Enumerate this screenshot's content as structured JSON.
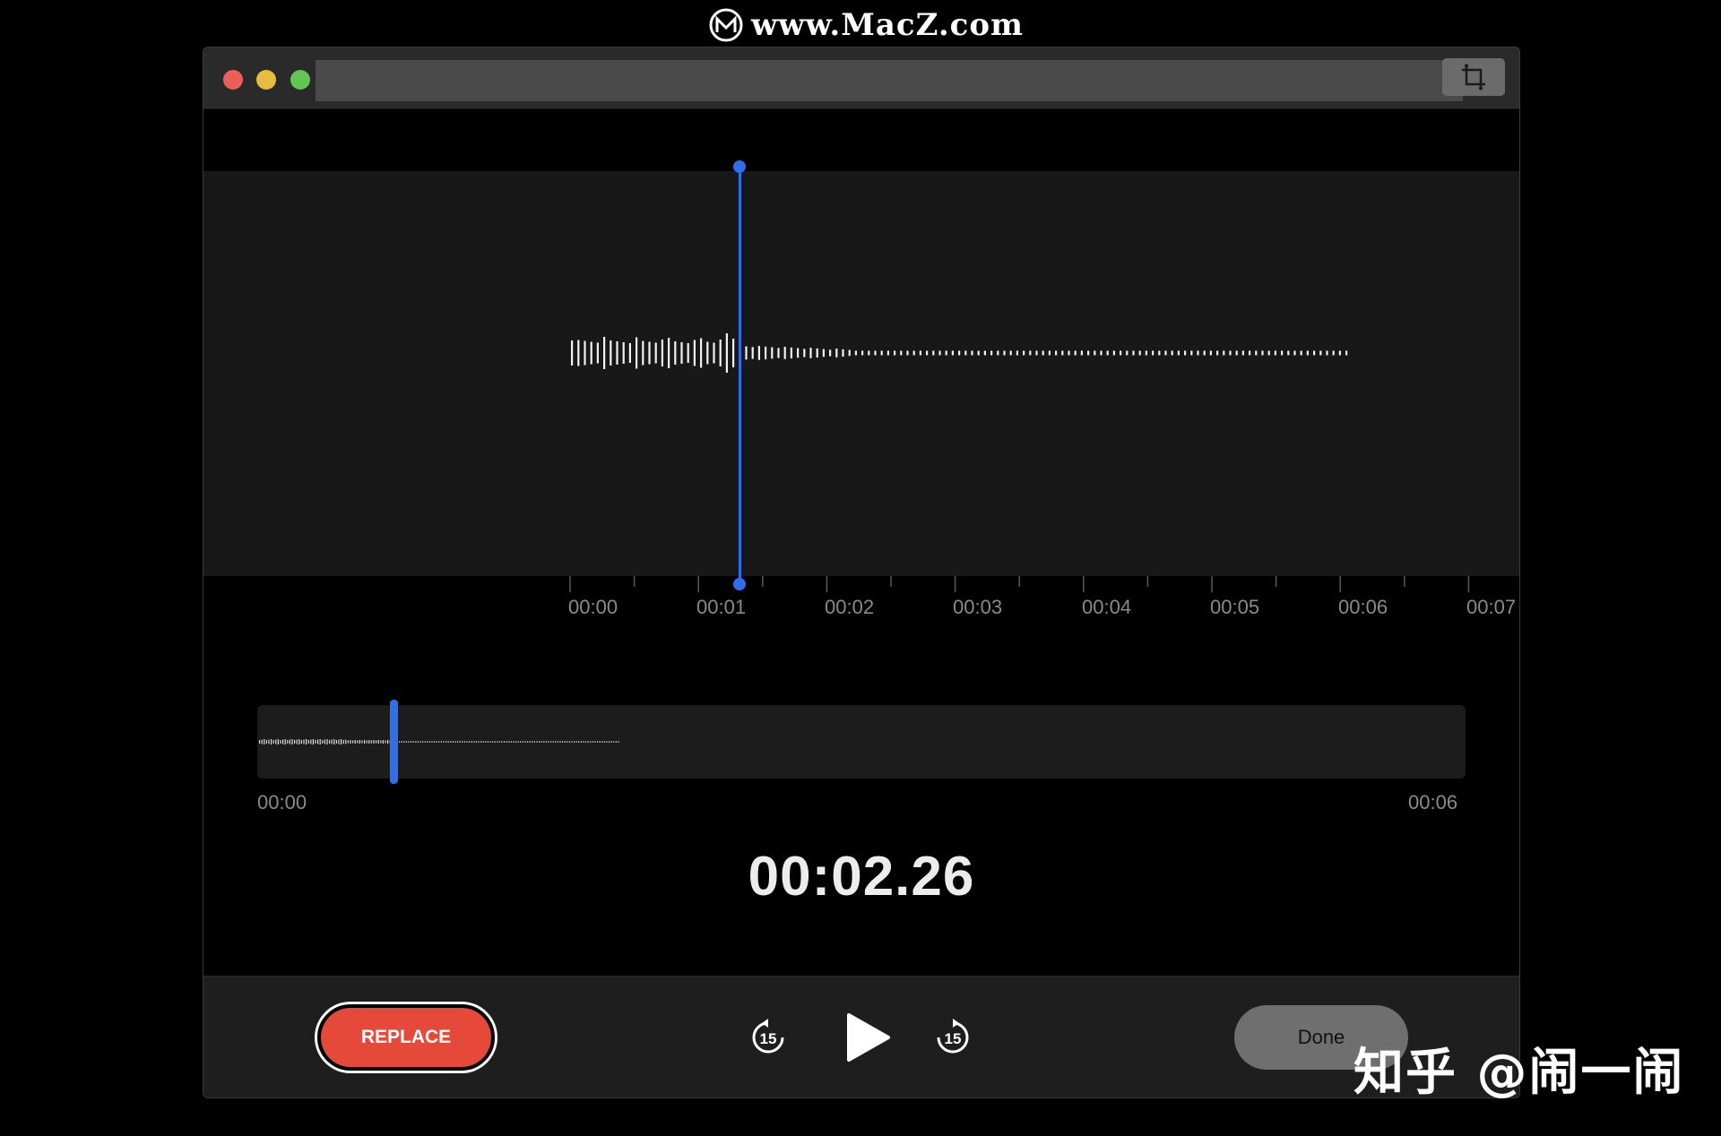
{
  "watermarks": {
    "top": "www.MacZ.com",
    "top_icon": "macz-logo-icon",
    "bottom": "知乎 @闹一闹"
  },
  "window": {
    "traffic_lights": {
      "close_color": "#ec5f57",
      "minimize_color": "#e5bd43",
      "maximize_color": "#62c554"
    },
    "crop_icon": "crop-icon"
  },
  "timeline": {
    "ticks": [
      "00:00",
      "00:01",
      "00:02",
      "00:03",
      "00:04",
      "00:05",
      "00:06",
      "00:07"
    ],
    "playhead_seconds": 2.26,
    "accent_color": "#2f6fec"
  },
  "overview": {
    "start_label": "00:00",
    "end_label": "00:06",
    "position_fraction": 0.113
  },
  "current_time": "00:02.26",
  "controls": {
    "replace_label": "REPLACE",
    "replace_color": "#e5493a",
    "skip_back_label": "15",
    "skip_forward_label": "15",
    "play_icon": "play-icon",
    "done_label": "Done"
  }
}
